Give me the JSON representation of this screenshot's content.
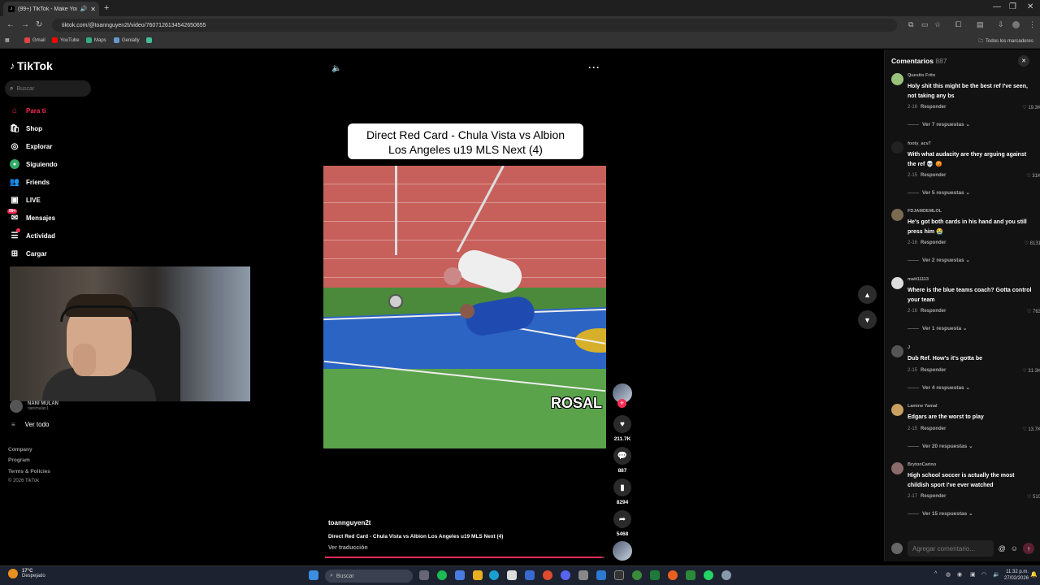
{
  "browser": {
    "tab_title": "(99+) TikTok - Make Your D...",
    "url": "tiktok.com/@toannguyen2t/video/7607126134542650655",
    "bookmarks": [
      "Gmail",
      "YouTube",
      "Maps",
      "Genially"
    ],
    "all_bookmarks": "Todos los marcadores"
  },
  "sidebar": {
    "logo": "TikTok",
    "search_placeholder": "Buscar",
    "items": [
      {
        "label": "Para ti",
        "icon": "home-icon"
      },
      {
        "label": "Shop",
        "icon": "shop-icon"
      },
      {
        "label": "Explorar",
        "icon": "compass-icon"
      },
      {
        "label": "Siguiendo",
        "icon": "following-icon"
      },
      {
        "label": "Friends",
        "icon": "friends-icon"
      },
      {
        "label": "LIVE",
        "icon": "live-icon"
      },
      {
        "label": "Mensajes",
        "icon": "messages-icon",
        "badge": "99+"
      },
      {
        "label": "Actividad",
        "icon": "activity-icon"
      },
      {
        "label": "Cargar",
        "icon": "upload-icon"
      }
    ],
    "account_name": "NANI MULAN",
    "account_handle": "nanimulan1",
    "see_all": "Ver todo",
    "footer": [
      "Company",
      "Program",
      "Terms & Policies"
    ],
    "copyright": "© 2026 TikTok"
  },
  "video": {
    "title_line1": "Direct Red Card - Chula Vista vs Albion",
    "title_line2": "Los Angeles u19 MLS Next (4)",
    "overlay_text": "ROSAL",
    "author": "toannguyen2t",
    "description": "Direct Red Card - Chula Vista vs Albion Los Angeles u19 MLS Next (4)",
    "translate": "Ver traducción",
    "progress": 0.99
  },
  "actions": {
    "likes": "211.7K",
    "comments": "887",
    "saves": "8294",
    "shares": "5468"
  },
  "comments_panel": {
    "title": "Comentarios",
    "count": "887",
    "reply_label": "Responder",
    "input_placeholder": "Agregar comentario...",
    "items": [
      {
        "user": "Quesito Frito",
        "text": "Holy shit this might be the best ref I've seen, not taking any bs",
        "date": "2-16",
        "likes": "19.3K",
        "more": "Ver 7 respuestas",
        "avatar_color": "#9bc27a"
      },
      {
        "user": "footy_acv7",
        "text": "With what audacity are they arguing against the ref 💀 😡",
        "date": "2-15",
        "likes": "31K",
        "more": "Ver 5 respuestas",
        "avatar_color": "#222222"
      },
      {
        "user": "FDJAMDEMLOL",
        "text": "He's got both cards in his hand and you still press him 😭",
        "date": "2-16",
        "likes": "8131",
        "more": "Ver 2 respuestas",
        "avatar_color": "#7a6a50"
      },
      {
        "user": "matt11113",
        "text": "Where is the blue teams coach? Gotta control your team",
        "date": "2-16",
        "likes": "763",
        "more": "Ver 1 respuesta",
        "avatar_color": "#dddddd"
      },
      {
        "user": "J",
        "text": "Dub Ref. How's it's gotta be",
        "date": "2-15",
        "likes": "31.3K",
        "more": "Ver 4 respuestas",
        "avatar_color": "#555555"
      },
      {
        "user": "Lamine Yamal",
        "text": "Edgars are the worst to play",
        "date": "2-15",
        "likes": "13.7K",
        "more": "Ver 20 respuestas",
        "avatar_color": "#c8a060"
      },
      {
        "user": "BrytonCarino",
        "text": "High school soccer is actually the most childish sport I've ever watched",
        "date": "2-17",
        "likes": "510",
        "more": "Ver 15 respuestas",
        "avatar_color": "#8a6a6a"
      }
    ]
  },
  "taskbar": {
    "temp": "17°C",
    "weather": "Despejado",
    "search": "Buscar",
    "time": "11:32 p.m.",
    "date": "27/02/2026"
  }
}
